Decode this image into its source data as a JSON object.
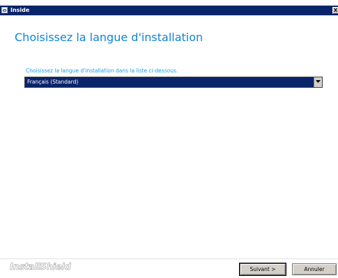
{
  "window": {
    "title": "Inside",
    "close_label": "X",
    "icons": {
      "app": "app-icon",
      "close": "close-icon"
    }
  },
  "page": {
    "heading": "Choisissez la langue d'installation",
    "instruction": "Choisissez la langue d'installation dans la liste ci-dessous."
  },
  "language_select": {
    "selected_value": "Français (Standard)",
    "icon": "chevron-down-icon"
  },
  "footer": {
    "brand": "InstallShield",
    "next_label": "Suivant >",
    "cancel_label": "Annuler"
  },
  "colors": {
    "titlebar": "#0a246a",
    "heading": "#0d86d9",
    "instruction": "#1e9bea",
    "selection": "#0a246a",
    "button_face": "#d4d0c8"
  }
}
